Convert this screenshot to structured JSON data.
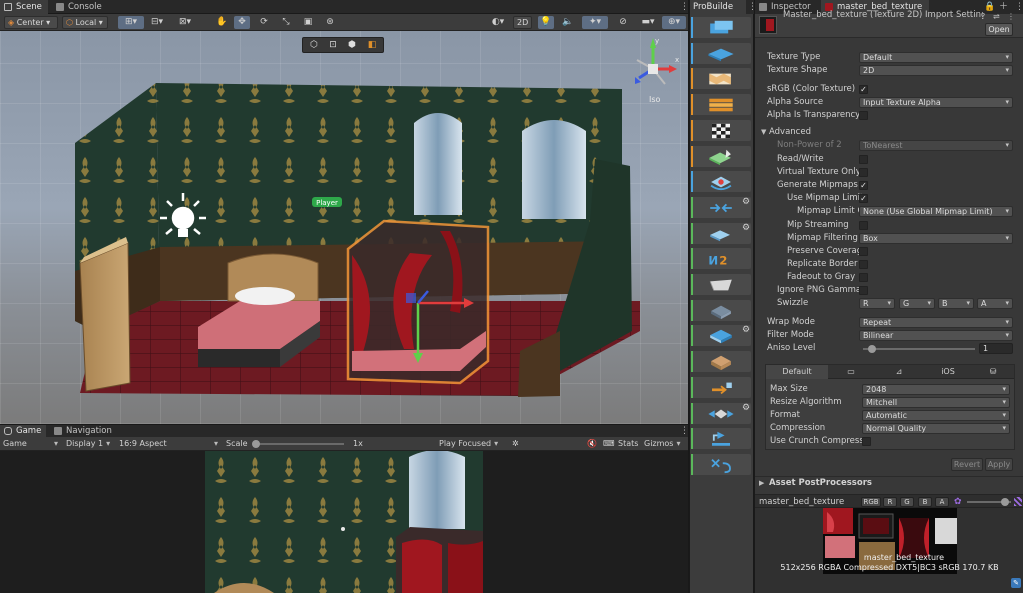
{
  "colors": {
    "accent": "#3a79bb",
    "probuilder_blue": "#4aa3df",
    "probuilder_orange": "#e0902a",
    "selection_orange": "#f29538",
    "wall_green": "#243d31",
    "floor_red": "#7a1e25"
  },
  "scene": {
    "tabs": [
      {
        "label": "Scene",
        "icon": "grid-icon"
      },
      {
        "label": "Console",
        "icon": "console-icon"
      }
    ],
    "toolbar": {
      "pivot_mode": "Center",
      "pivot_rotation": "Local",
      "toggle_2d": "2D"
    },
    "labels": {
      "player": "Player",
      "projection": "Iso",
      "axis_x": "x",
      "axis_y": "y"
    }
  },
  "game": {
    "tabs": [
      {
        "label": "Game",
        "icon": "game-icon"
      },
      {
        "label": "Navigation",
        "icon": "navigation-icon"
      }
    ],
    "toolbar": {
      "mode": "Game",
      "display": "Display 1",
      "aspect": "16:9 Aspect",
      "scale_label": "Scale",
      "scale_value": "1x",
      "play_mode": "Play Focused",
      "stats": "Stats",
      "gizmos": "Gizmos"
    }
  },
  "probuilder": {
    "tab_label": "ProBuilde",
    "tools": [
      {
        "name": "new-shape",
        "strip": "#4aa3df"
      },
      {
        "name": "poly-shape",
        "strip": "#4aa3df"
      },
      {
        "name": "smoothing",
        "strip": "#e0902a"
      },
      {
        "name": "material-editor",
        "strip": "#e0902a"
      },
      {
        "name": "uv-editor",
        "strip": "#e0902a"
      },
      {
        "name": "vertex-colors",
        "strip": "#e0902a"
      },
      {
        "name": "new-bezier",
        "strip": "#4aa3df"
      },
      {
        "name": "merge-objects",
        "strip": "#5bb85b",
        "gear": true
      },
      {
        "name": "mirror-objects",
        "strip": "#5bb85b",
        "gear": true
      },
      {
        "name": "flip-normals",
        "strip": "#5bb85b"
      },
      {
        "name": "conform-normals",
        "strip": "#5bb85b"
      },
      {
        "name": "center-pivot",
        "strip": "#5bb85b"
      },
      {
        "name": "freeze-transform",
        "strip": "#5bb85b",
        "gear": true
      },
      {
        "name": "triangulate",
        "strip": "#5bb85b"
      },
      {
        "name": "subdivide",
        "strip": "#5bb85b"
      },
      {
        "name": "export",
        "strip": "#5bb85b",
        "gear": true
      },
      {
        "name": "pro-builderize",
        "strip": "#5bb85b"
      },
      {
        "name": "set-trigger",
        "strip": "#5bb85b"
      }
    ]
  },
  "inspector": {
    "tabs": [
      {
        "label": "Inspector",
        "icon": "inspector-icon"
      },
      {
        "label": "master_bed_texture",
        "icon": "texture-icon"
      }
    ],
    "header_title": "Master_bed_texture (Texture 2D) Import Setting",
    "open_button": "Open",
    "fields": {
      "texture_type": {
        "label": "Texture Type",
        "value": "Default"
      },
      "texture_shape": {
        "label": "Texture Shape",
        "value": "2D"
      },
      "srgb": {
        "label": "sRGB (Color Texture)",
        "checked": true
      },
      "alpha_source": {
        "label": "Alpha Source",
        "value": "Input Texture Alpha"
      },
      "alpha_transparency": {
        "label": "Alpha Is Transparency",
        "checked": false
      },
      "advanced": {
        "label": "Advanced"
      },
      "non_power_of_2": {
        "label": "Non-Power of 2",
        "value": "ToNearest"
      },
      "read_write": {
        "label": "Read/Write",
        "checked": false
      },
      "virtual_texture_only": {
        "label": "Virtual Texture Only",
        "checked": false
      },
      "generate_mipmaps": {
        "label": "Generate Mipmaps",
        "checked": true
      },
      "use_mipmap_limits": {
        "label": "Use Mipmap Limits",
        "checked": true
      },
      "mipmap_limit_group": {
        "label": "Mipmap Limit Gr",
        "value": "None (Use Global Mipmap Limit)"
      },
      "mip_streaming": {
        "label": "Mip Streaming",
        "checked": false
      },
      "mipmap_filtering": {
        "label": "Mipmap Filtering",
        "value": "Box"
      },
      "preserve_coverage": {
        "label": "Preserve Coverage",
        "checked": false
      },
      "replicate_border": {
        "label": "Replicate Border",
        "checked": false
      },
      "fadeout_to_gray": {
        "label": "Fadeout to Gray",
        "checked": false
      },
      "ignore_png_gamma": {
        "label": "Ignore PNG Gamma",
        "checked": false
      },
      "swizzle": {
        "label": "Swizzle",
        "values": [
          "R",
          "G",
          "B",
          "A"
        ]
      },
      "wrap_mode": {
        "label": "Wrap Mode",
        "value": "Repeat"
      },
      "filter_mode": {
        "label": "Filter Mode",
        "value": "Bilinear"
      },
      "aniso_level": {
        "label": "Aniso Level",
        "value": "1",
        "fraction": 0.05
      }
    },
    "platform": {
      "tabs": [
        {
          "label": "Default",
          "icon": "default-icon"
        },
        {
          "label": "",
          "icon": "monitor-icon"
        },
        {
          "label": "",
          "icon": "android-icon"
        },
        {
          "label": "iOS",
          "icon": "ios-icon"
        },
        {
          "label": "",
          "icon": "webgl-icon"
        }
      ],
      "max_size": {
        "label": "Max Size",
        "value": "2048"
      },
      "resize_algorithm": {
        "label": "Resize Algorithm",
        "value": "Mitchell"
      },
      "format": {
        "label": "Format",
        "value": "Automatic"
      },
      "compression": {
        "label": "Compression",
        "value": "Normal Quality"
      },
      "use_crunch": {
        "label": "Use Crunch Compression",
        "checked": false
      }
    },
    "revert_button": "Revert",
    "apply_button": "Apply",
    "asset_postprocessors": "Asset PostProcessors",
    "preview": {
      "name": "master_bed_texture",
      "channels": [
        "RGB",
        "R",
        "G",
        "B",
        "A"
      ],
      "overlay_name": "master_bed_texture",
      "info": "512x256  RGBA Compressed DXT5|BC3 sRGB  170.7 KB"
    }
  }
}
